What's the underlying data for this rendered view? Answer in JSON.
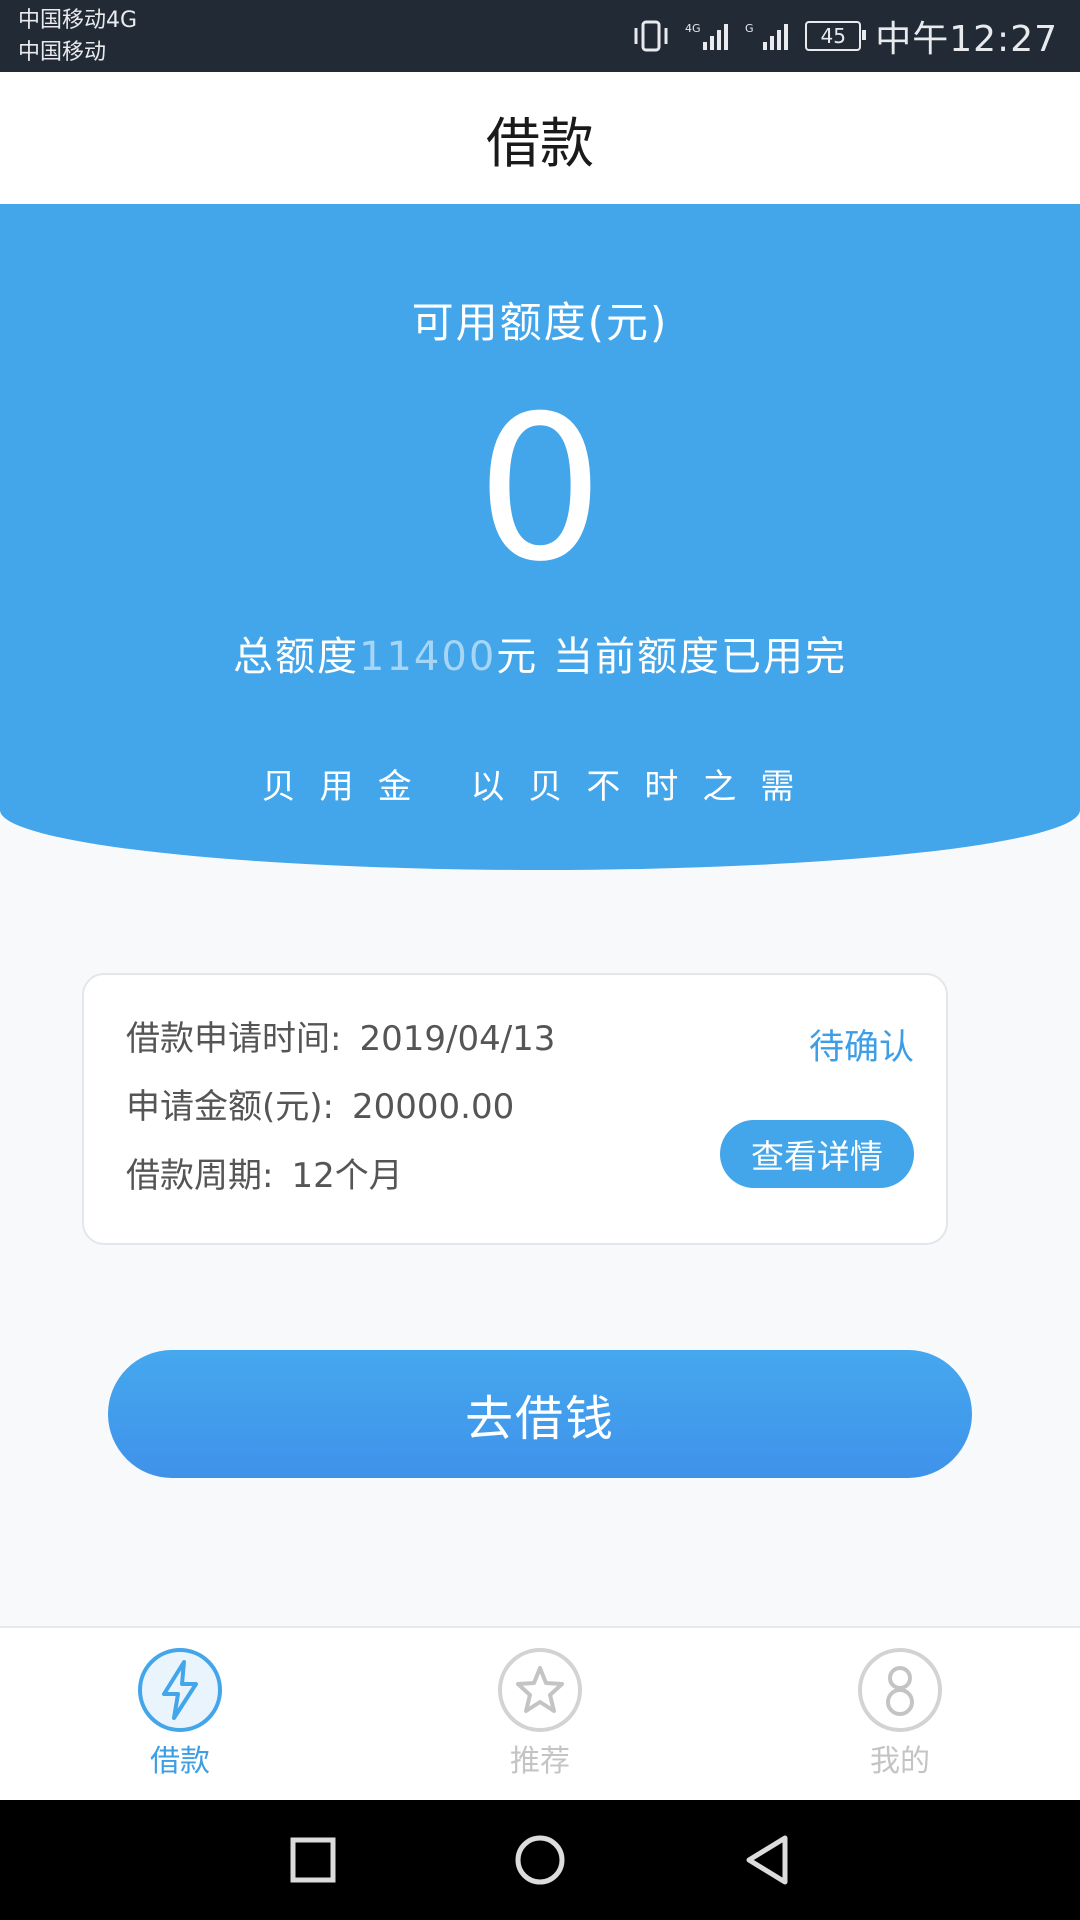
{
  "status_bar": {
    "carrier_1": "中国移动4G",
    "carrier_2": "中国移动",
    "battery": "45",
    "time": "中午12:27",
    "icons": [
      "vibrate-icon",
      "signal-4g-icon",
      "signal-g-icon",
      "battery-icon"
    ]
  },
  "header": {
    "title": "借款"
  },
  "hero": {
    "label": "可用额度(元)",
    "value": "0",
    "summary_prefix": "总额度",
    "total_amount": "11400",
    "summary_suffix": "元 当前额度已用完",
    "slogan": "贝用金 以贝不时之需"
  },
  "loan_record": {
    "time_label": "借款申请时间:",
    "time_value": "2019/04/13",
    "amount_label": "申请金额(元):",
    "amount_value": "20000.00",
    "term_label": "借款周期:",
    "term_value": "12个月",
    "status": "待确认",
    "detail_button": "查看详情"
  },
  "cta": {
    "label": "去借钱"
  },
  "tabs": [
    {
      "label": "借款",
      "icon": "lightning-icon",
      "active": true
    },
    {
      "label": "推荐",
      "icon": "star-icon",
      "active": false
    },
    {
      "label": "我的",
      "icon": "profile-icon",
      "active": false
    }
  ],
  "system_nav": [
    "recent-apps-icon",
    "home-icon",
    "back-icon"
  ],
  "colors": {
    "accent": "#43a5ea",
    "status_bar_bg": "#222b35",
    "tab_active": "#3d9ee6",
    "tab_inactive": "#c4c4c4"
  }
}
